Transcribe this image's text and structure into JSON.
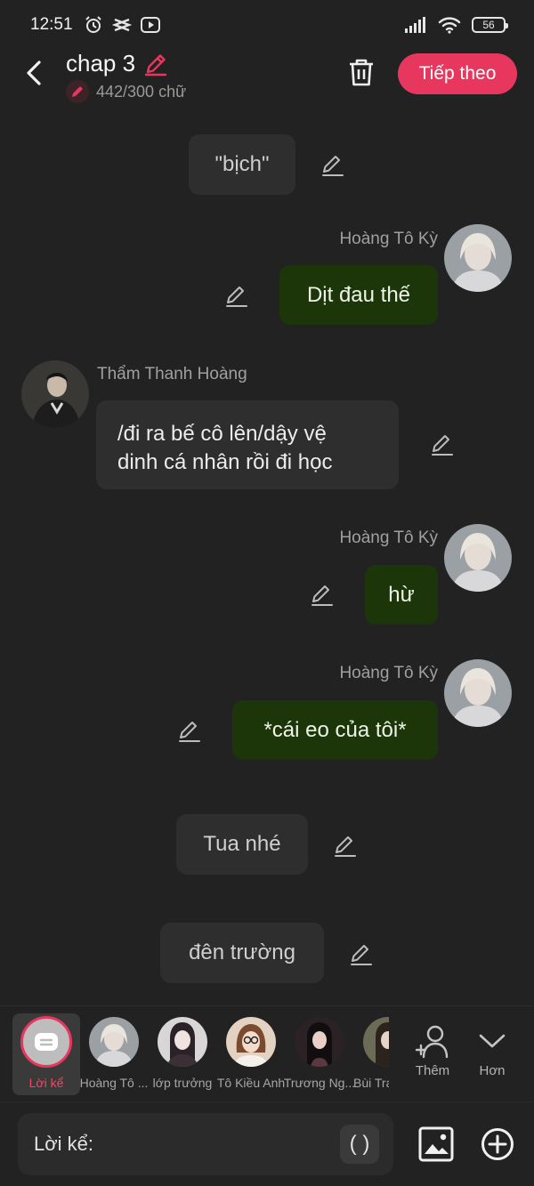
{
  "status": {
    "time": "12:51",
    "battery": "56"
  },
  "header": {
    "title": "chap 3",
    "word_count": "442/300 chữ",
    "next_label": "Tiếp theo"
  },
  "messages": [
    {
      "type": "narration",
      "text": "\"bịch\""
    },
    {
      "type": "right",
      "name": "Hoàng Tô Kỳ",
      "text": "Dịt đau thế"
    },
    {
      "type": "left",
      "name": "Thẩm Thanh Hoàng",
      "line1": "/đi ra bế cô lên/dậy vệ",
      "line2": "dinh cá nhân rồi đi học"
    },
    {
      "type": "right",
      "name": "Hoàng Tô Kỳ",
      "text": "hừ"
    },
    {
      "type": "right",
      "name": "Hoàng Tô Kỳ",
      "text": "*cái eo của tôi*"
    },
    {
      "type": "narration",
      "text": "Tua nhé"
    },
    {
      "type": "narration",
      "text": "đên trường"
    }
  ],
  "characters": [
    {
      "label": "Lời kể"
    },
    {
      "label": "Hoàng Tô ..."
    },
    {
      "label": "lớp trưởng"
    },
    {
      "label": "Tô Kiều Anh"
    },
    {
      "label": "Trương Ng..."
    },
    {
      "label": "Bùi Tra"
    }
  ],
  "bar_actions": {
    "add_label": "Thêm",
    "more_label": "Hơn"
  },
  "input": {
    "label": "Lời kể:",
    "paren": "( )"
  },
  "colors": {
    "accent": "#e8375e",
    "bubble_green": "#1d3609",
    "background": "#222222"
  }
}
